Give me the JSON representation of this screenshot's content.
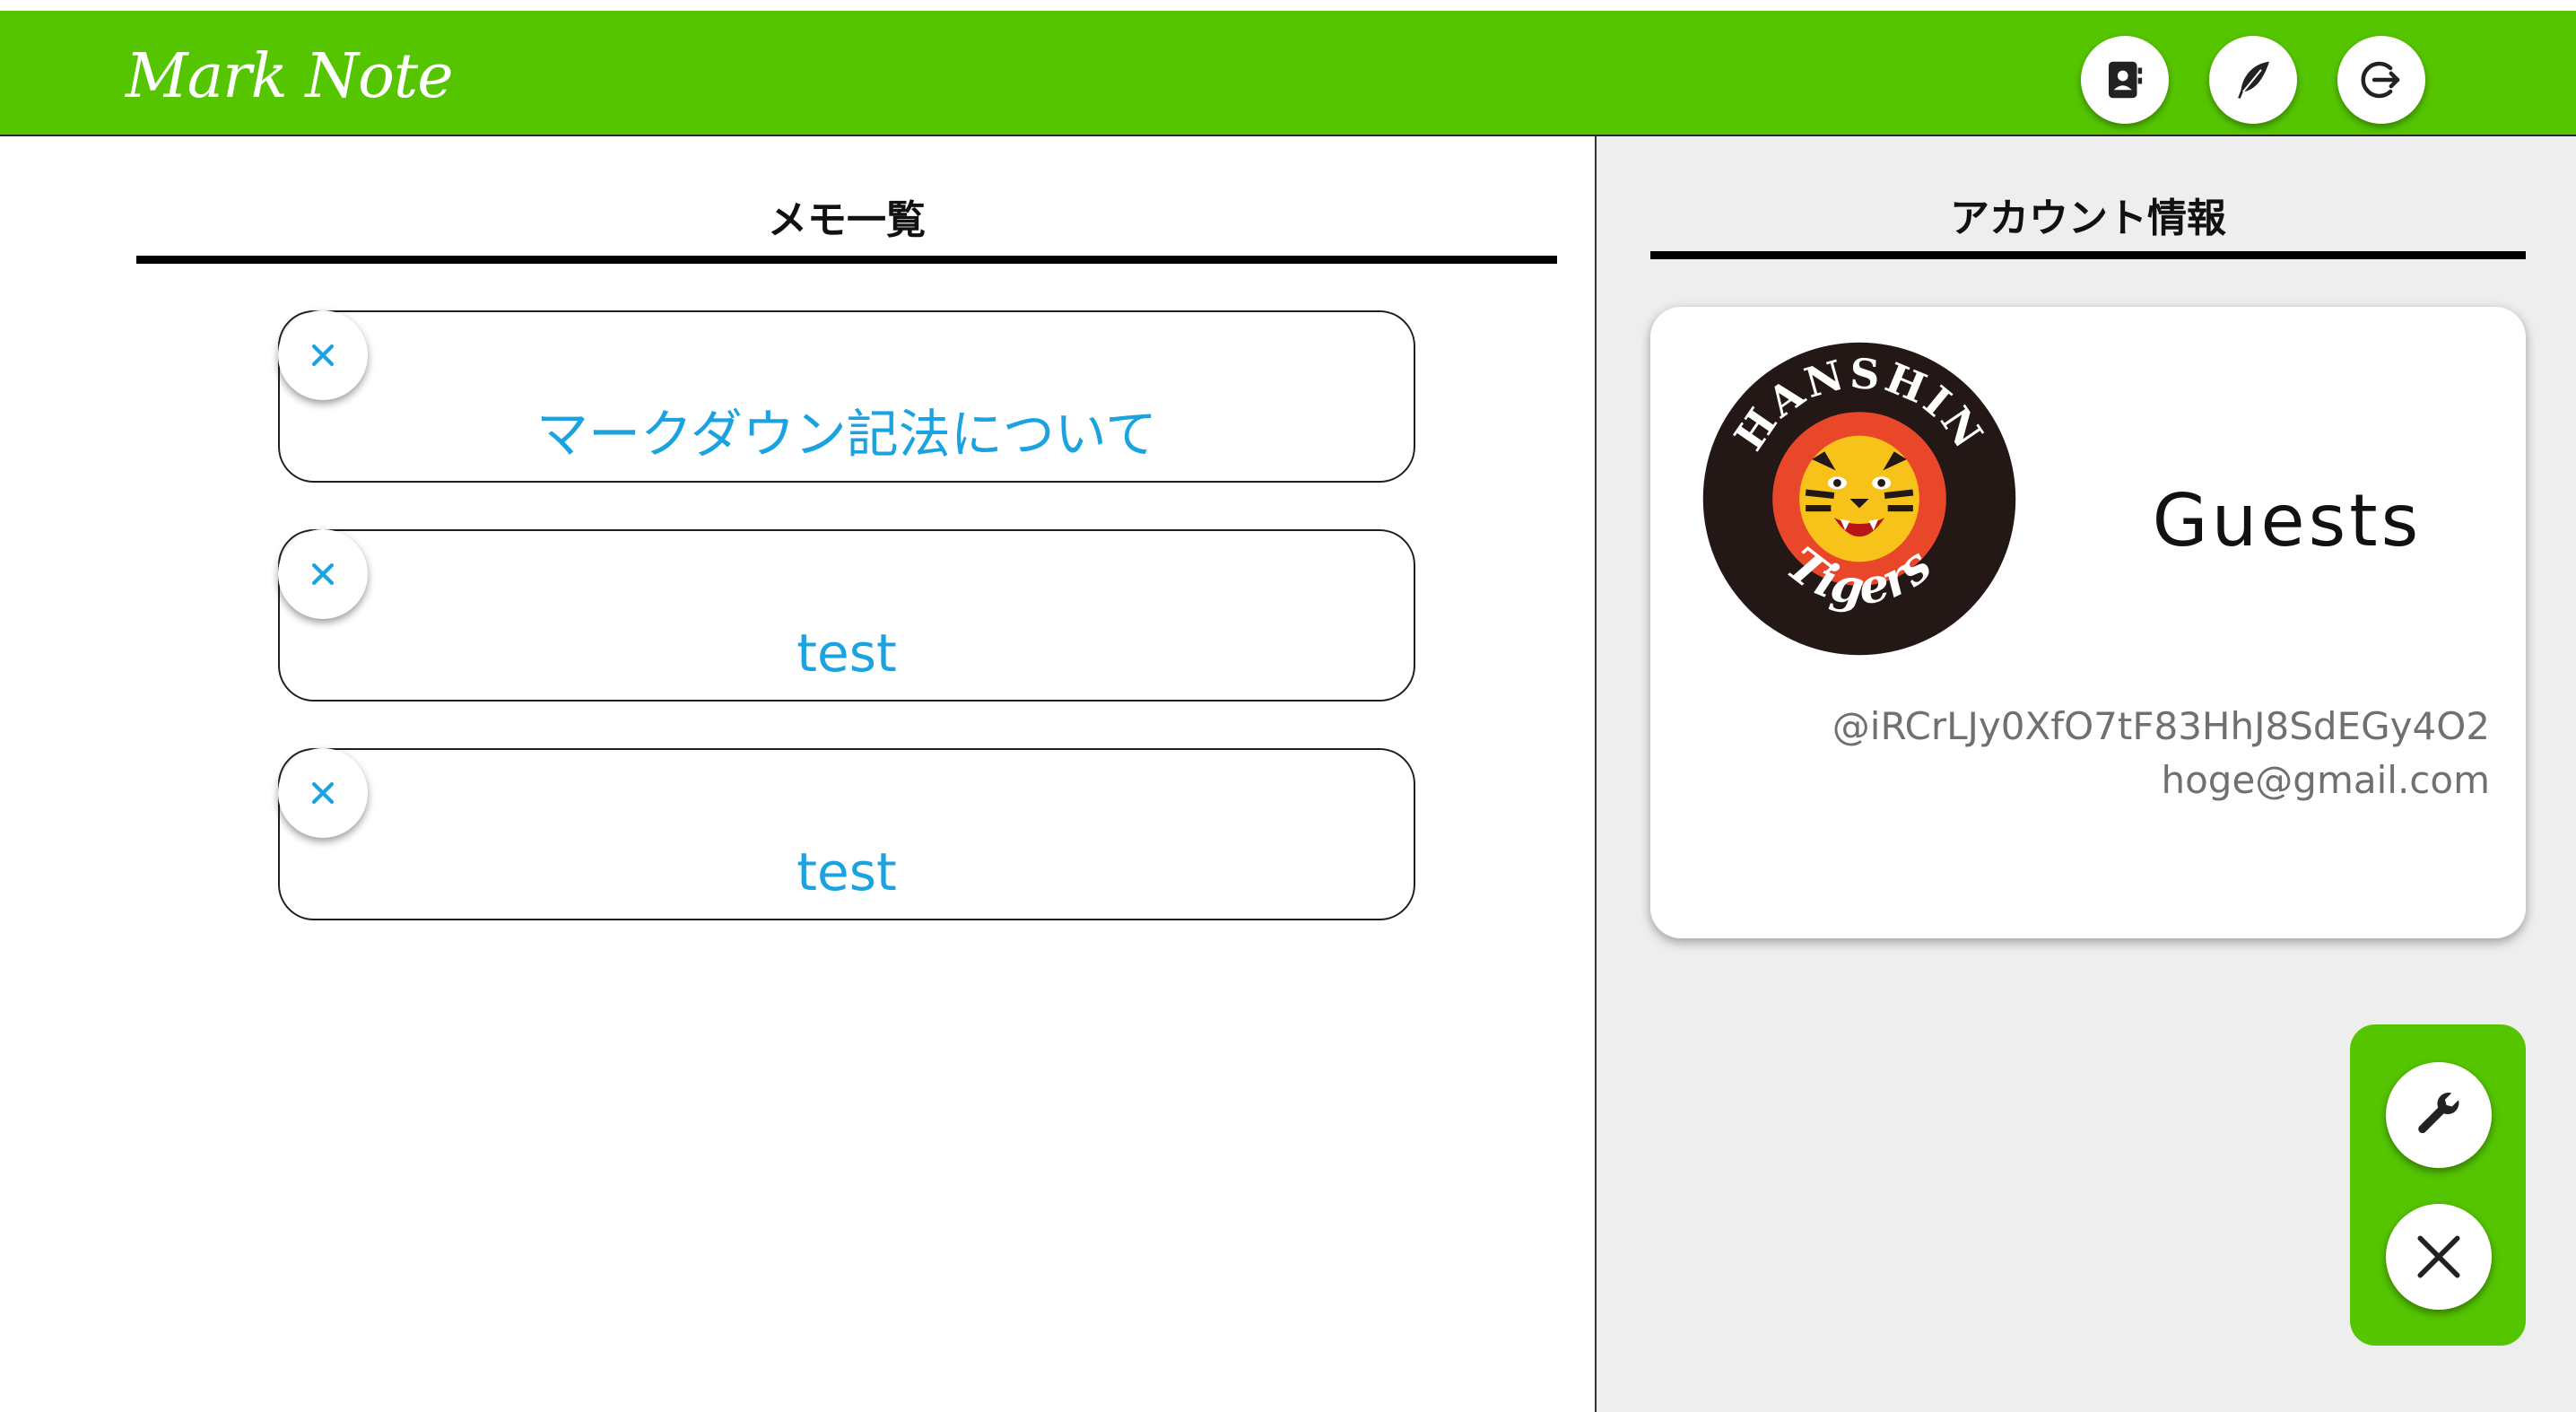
{
  "app": {
    "brand": "Mark Note",
    "accent_color": "#55c500",
    "link_color": "#1aa3e0"
  },
  "header": {
    "buttons": [
      {
        "name": "address-book-icon",
        "interactable": true
      },
      {
        "name": "feather-pen-icon",
        "interactable": true
      },
      {
        "name": "logout-icon",
        "interactable": true
      }
    ]
  },
  "memos": {
    "heading": "メモ一覧",
    "items": [
      {
        "title": "マークダウン記法について",
        "delete_icon": "close-icon"
      },
      {
        "title": "test",
        "delete_icon": "close-icon"
      },
      {
        "title": "test",
        "delete_icon": "close-icon"
      }
    ]
  },
  "account": {
    "heading": "アカウント情報",
    "avatar_icon": "hanshin-tigers-logo",
    "avatar_text_top": "HANSHIN",
    "avatar_text_bottom": "Tigers",
    "name": "Guests",
    "id": "@iRCrLJy0XfO7tF83HhJ8SdEGy4O2",
    "email": "hoge@gmail.com"
  },
  "actions": {
    "settings_icon": "wrench-icon",
    "close_icon": "close-icon"
  }
}
